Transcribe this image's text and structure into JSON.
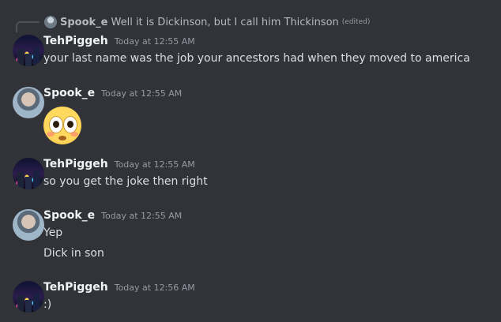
{
  "reply": {
    "author": "Spook_e",
    "text": "Well it is Dickinson, but I call him Thickinson",
    "edited": "(edited)"
  },
  "messages": [
    {
      "author": "TehPiggeh",
      "time": "Today at 12:55 AM",
      "lines": [
        "your last name was the job your ancestors had when they moved to america"
      ]
    },
    {
      "author": "Spook_e",
      "time": "Today at 12:55 AM",
      "emoji": "flushed-face-emoji"
    },
    {
      "author": "TehPiggeh",
      "time": "Today at 12:55 AM",
      "lines": [
        "so you get the joke then right"
      ]
    },
    {
      "author": "Spook_e",
      "time": "Today at 12:55 AM",
      "lines": [
        "Yep",
        "Dick in son"
      ]
    },
    {
      "author": "TehPiggeh",
      "time": "Today at 12:56 AM",
      "lines": [
        ":)"
      ]
    }
  ]
}
